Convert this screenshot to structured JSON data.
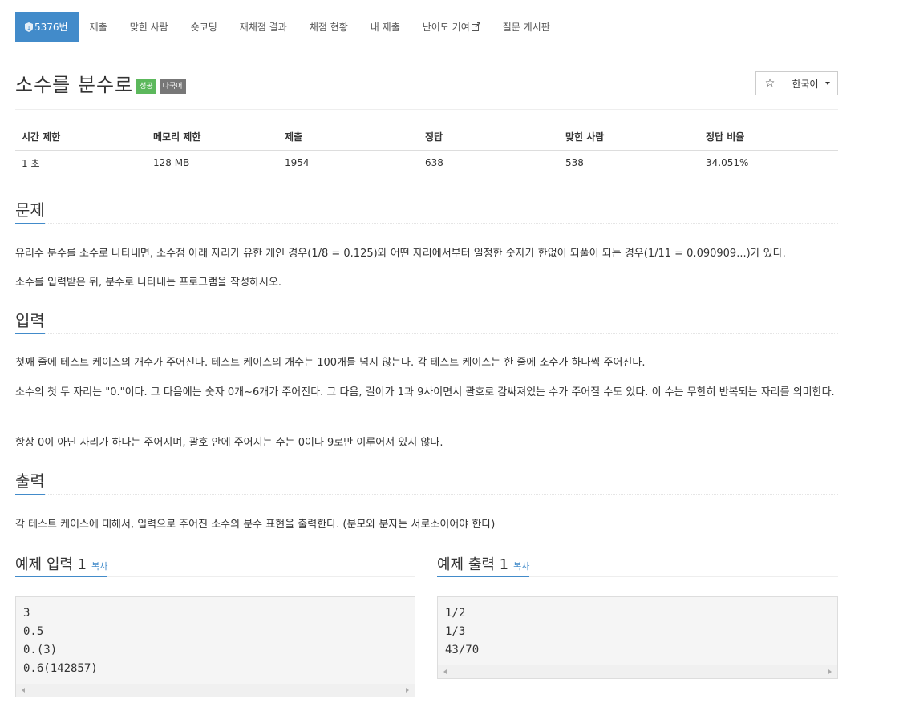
{
  "nav": {
    "items": [
      {
        "label": "5376번"
      },
      {
        "label": "제출"
      },
      {
        "label": "맞힌 사람"
      },
      {
        "label": "숏코딩"
      },
      {
        "label": "재채점 결과"
      },
      {
        "label": "채점 현황"
      },
      {
        "label": "내 제출"
      },
      {
        "label": "난이도 기여"
      },
      {
        "label": "질문 게시판"
      }
    ]
  },
  "problem": {
    "title": "소수를 분수로",
    "badges": [
      "성공",
      "다국어"
    ],
    "star": "☆",
    "language": "한국어"
  },
  "info_table": {
    "headers": [
      "시간 제한",
      "메모리 제한",
      "제출",
      "정답",
      "맞힌 사람",
      "정답 비율"
    ],
    "values": [
      "1 초",
      "128 MB",
      "1954",
      "638",
      "538",
      "34.051%"
    ]
  },
  "sections": {
    "description": {
      "title": "문제",
      "paragraphs": [
        "유리수 분수를 소수로 나타내면, 소수점 아래 자리가 유한 개인 경우(1/8 = 0.125)와 어떤 자리에서부터 일정한 숫자가 한없이 되풀이 되는 경우(1/11 = 0.090909...)가 있다.",
        "소수를 입력받은 뒤, 분수로 나타내는 프로그램을 작성하시오."
      ]
    },
    "input": {
      "title": "입력",
      "paragraphs": [
        "첫째 줄에 테스트 케이스의 개수가 주어진다. 테스트 케이스의 개수는 100개를 넘지 않는다. 각 테스트 케이스는 한 줄에 소수가 하나씩 주어진다.",
        "소수의 첫 두 자리는 \"0.\"이다. 그 다음에는 숫자 0개~6개가 주어진다. 그 다음, 길이가 1과 9사이면서 괄호로 감싸져있는 수가 주어질 수도 있다. 이 수는 무한히 반복되는 자리를 의미한다.",
        "항상 0이 아닌 자리가 하나는 주어지며, 괄호 안에 주어지는 수는 0이나 9로만 이루어져 있지 않다."
      ]
    },
    "output": {
      "title": "출력",
      "paragraphs": [
        "각 테스트 케이스에 대해서, 입력으로 주어진 소수의 분수 표현을 출력한다. (분모와 분자는 서로소이어야 한다)"
      ]
    }
  },
  "samples": {
    "input": {
      "title": "예제 입력 1",
      "copy": "복사",
      "lines": "3\n0.5\n0.(3)\n0.6(142857)"
    },
    "output": {
      "title": "예제 출력 1",
      "copy": "복사",
      "lines": "1/2\n1/3\n43/70"
    }
  }
}
